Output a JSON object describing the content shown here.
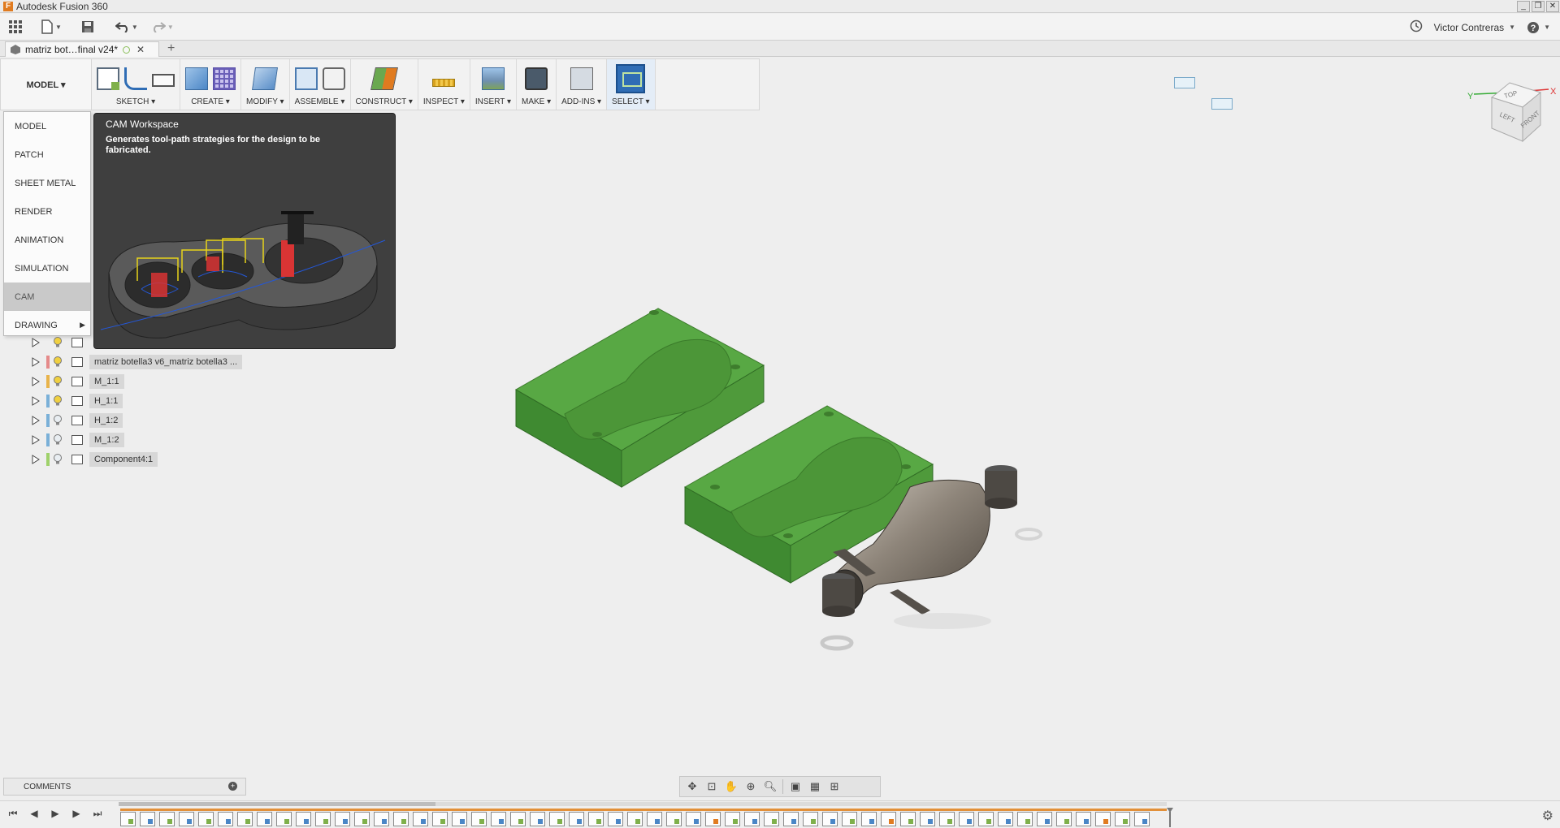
{
  "window": {
    "title": "Autodesk Fusion 360",
    "app_icon_letter": "F",
    "controls": [
      "_",
      "❐",
      "✕"
    ]
  },
  "quick_access": {
    "user_name": "Victor Contreras"
  },
  "document_tab": {
    "title": "matriz bot…final v24*"
  },
  "toolbar": {
    "workspace_label": "MODEL ▾",
    "groups": [
      {
        "label": "SKETCH ▾"
      },
      {
        "label": "CREATE ▾"
      },
      {
        "label": "MODIFY ▾"
      },
      {
        "label": "ASSEMBLE ▾"
      },
      {
        "label": "CONSTRUCT ▾"
      },
      {
        "label": "INSPECT ▾"
      },
      {
        "label": "INSERT ▾"
      },
      {
        "label": "MAKE ▾"
      },
      {
        "label": "ADD-INS ▾"
      },
      {
        "label": "SELECT ▾"
      }
    ]
  },
  "workspace_menu": {
    "items": [
      {
        "label": "MODEL"
      },
      {
        "label": "PATCH"
      },
      {
        "label": "SHEET METAL"
      },
      {
        "label": "RENDER"
      },
      {
        "label": "ANIMATION"
      },
      {
        "label": "SIMULATION"
      },
      {
        "label": "CAM"
      },
      {
        "label": "DRAWING"
      }
    ],
    "highlighted": "CAM"
  },
  "tooltip": {
    "title": "CAM Workspace",
    "description": "Generates tool-path strategies for the design to be fabricated."
  },
  "browser": {
    "rows": [
      {
        "label": "",
        "color": "#9a9a9a"
      },
      {
        "label": "matriz botella3 v6_matriz botella3 ...",
        "color": "#e58a8a"
      },
      {
        "label": "M_1:1",
        "color": "#e8b34a"
      },
      {
        "label": "H_1:1",
        "color": "#7ab0d8"
      },
      {
        "label": "H_1:2",
        "color": "#7ab0d8"
      },
      {
        "label": "M_1:2",
        "color": "#7ab0d8"
      },
      {
        "label": "Component4:1",
        "color": "#9fd16b"
      }
    ]
  },
  "viewcube": {
    "top": "TOP",
    "front": "FRONT",
    "left": "LEFT",
    "axis_x": "X",
    "axis_y": "Y"
  },
  "comments": {
    "label": "COMMENTS"
  },
  "colors": {
    "mold_green": "#4f9a3b",
    "bottle_metal": "#8c8377",
    "accent_blue": "#2f6db5"
  }
}
